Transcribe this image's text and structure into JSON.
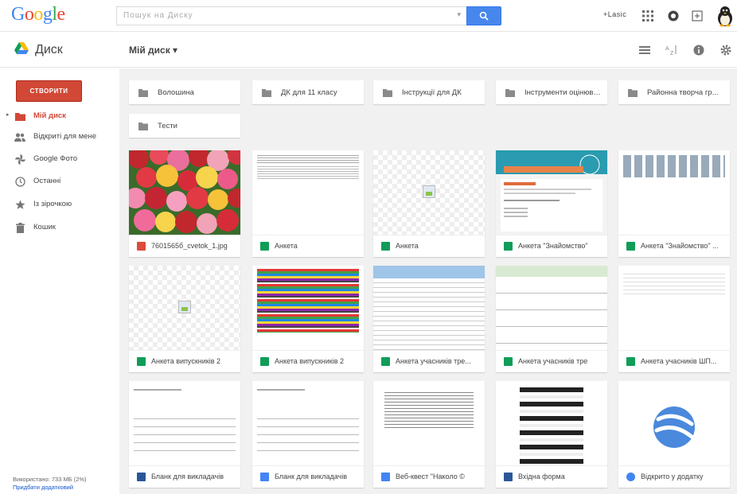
{
  "header": {
    "logo": "Google",
    "search_placeholder": "Пошук на Диску",
    "user_label": "+Lasic",
    "colors": {
      "search_btn": "#4787ed",
      "create_btn": "#d14836"
    }
  },
  "subheader": {
    "app_name": "Диск",
    "breadcrumb": "Мій диск ▾"
  },
  "sidebar": {
    "create_label": "СТВОРИТИ",
    "items": [
      {
        "label": "Мій диск",
        "icon": "folder-icon",
        "active": true
      },
      {
        "label": "Відкриті для мене",
        "icon": "people-icon",
        "active": false
      },
      {
        "label": "Google Фото",
        "icon": "pinwheel-icon",
        "active": false
      },
      {
        "label": "Останні",
        "icon": "clock-icon",
        "active": false
      },
      {
        "label": "Із зірочкою",
        "icon": "star-icon",
        "active": false
      },
      {
        "label": "Кошик",
        "icon": "trash-icon",
        "active": false
      }
    ],
    "storage_text": "Використано: 733 МБ (2%)",
    "storage_link": "Придбати додатковий"
  },
  "folders": [
    {
      "name": "Волошина"
    },
    {
      "name": "ДК для 11 класу"
    },
    {
      "name": "Інструкції для ДК"
    },
    {
      "name": "Інструменти оцінювання"
    },
    {
      "name": "Районна творча гр..."
    },
    {
      "name": "Тести"
    }
  ],
  "files": [
    {
      "name": "7601565б_cvetok_1.jpg",
      "type": "image"
    },
    {
      "name": "Анкета",
      "type": "sheet"
    },
    {
      "name": "Анкета",
      "type": "sheet"
    },
    {
      "name": "Анкета \"Знайомство\"",
      "type": "form"
    },
    {
      "name": "Анкета \"Знайомство\" ...",
      "type": "sheet"
    },
    {
      "name": "Анкета випускників 2",
      "type": "sheet"
    },
    {
      "name": "Анкета випускників 2",
      "type": "sheet"
    },
    {
      "name": "Анкета учасників тре...",
      "type": "sheet"
    },
    {
      "name": "Анкета учасників тре",
      "type": "form"
    },
    {
      "name": "Анкета учасників ШП...",
      "type": "sheet"
    },
    {
      "name": "Бланк для викладачів",
      "type": "word"
    },
    {
      "name": "Бланк для викладачів",
      "type": "doc"
    },
    {
      "name": "Веб-квест \"Наколо ©",
      "type": "doc"
    },
    {
      "name": "Вхідна форма",
      "type": "word"
    },
    {
      "name": "Відкрито у додатку",
      "type": "earth"
    }
  ],
  "type_colors": {
    "image": "#dd4b39",
    "sheet": "#0f9d58",
    "form": "#0f9d58",
    "word": "#2a5699",
    "doc": "#4285f4",
    "earth": "#4285f4"
  }
}
